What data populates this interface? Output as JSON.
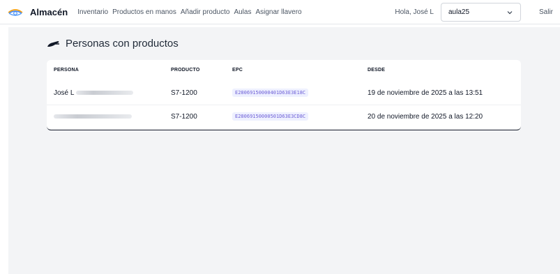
{
  "app": {
    "name": "Almacén",
    "logo_icon": "eye-logo-icon",
    "accent": "#2563eb"
  },
  "nav": {
    "links": [
      "Inventario",
      "Productos en manos",
      "Añadir producto",
      "Aulas",
      "Asignar llavero"
    ],
    "greeting": "Hola, José L",
    "classroom_selected": "aula25",
    "logout": "Salir"
  },
  "page": {
    "title": "Personas con productos",
    "title_icon": "hand-icon"
  },
  "table": {
    "headers": [
      "PERSONA",
      "PRODUCTO",
      "EPC",
      "DESDE"
    ],
    "rows": [
      {
        "persona": "José L",
        "producto": "S7-1200",
        "epc": "E28069150000401D63E3E18C",
        "desde": "19 de noviembre de 2025 a las 13:51"
      },
      {
        "persona": "",
        "producto": "S7-1200",
        "epc": "E28069150000501D63E3CD8C",
        "desde": "20 de noviembre de 2025 a las 12:20"
      }
    ]
  }
}
